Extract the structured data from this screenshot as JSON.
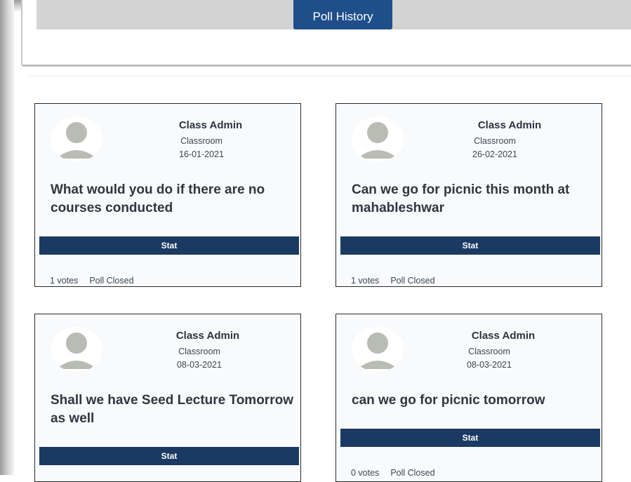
{
  "header": {
    "poll_history_label": "Poll History"
  },
  "polls": [
    {
      "author": "Class Admin",
      "group": "Classroom",
      "date": "16-01-2021",
      "question": "What would you do if there are no courses conducted",
      "stat_label": "Stat",
      "votes": "1 votes",
      "status": "Poll Closed"
    },
    {
      "author": "Class Admin",
      "group": "Classroom",
      "date": "26-02-2021",
      "question": "Can we go for picnic this month at mahableshwar",
      "stat_label": "Stat",
      "votes": "1 votes",
      "status": "Poll Closed"
    },
    {
      "author": "Class Admin",
      "group": "Classroom",
      "date": "08-03-2021",
      "question": "Shall we have Seed Lecture Tomorrow as well",
      "stat_label": "Stat",
      "votes": "",
      "status": ""
    },
    {
      "author": "Class Admin",
      "group": "Classroom",
      "date": "08-03-2021",
      "question": "can we go for picnic tomorrow",
      "stat_label": "Stat",
      "votes": "0 votes",
      "status": "Poll Closed"
    }
  ],
  "colors": {
    "accent_button": "#1f4f8a",
    "stat_bar": "#1b3a63",
    "avatar_silhouette": "#b9bbb5"
  },
  "icons": {
    "avatar": "user-silhouette-icon"
  }
}
